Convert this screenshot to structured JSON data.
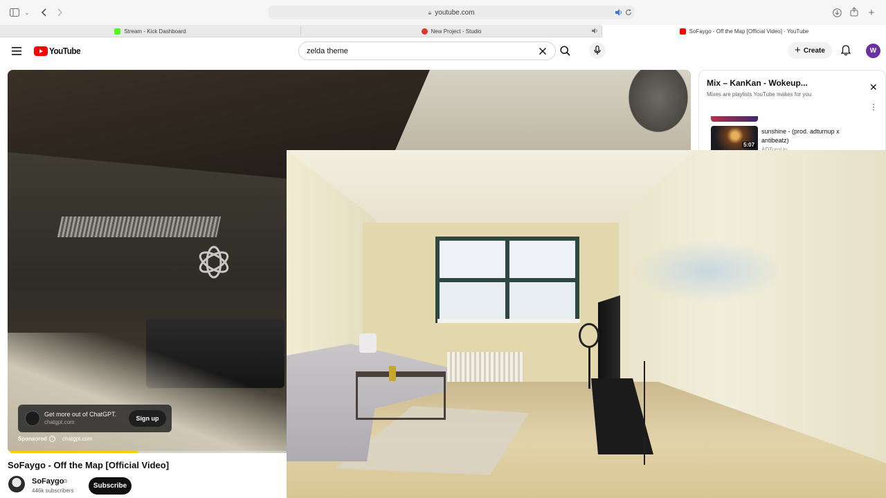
{
  "browser": {
    "address": "youtube.com",
    "tabs": [
      {
        "label": "Stream - Kick Dashboard",
        "favicon_color": "#53fc18"
      },
      {
        "label": "New Project - Studio",
        "favicon_color": "#e6332a"
      },
      {
        "label": "SoFaygo - Off the Map [Official Video] - YouTube",
        "favicon_color": "#ff0000"
      }
    ]
  },
  "youtube": {
    "logo_text": "YouTube",
    "search_value": "zelda theme",
    "create_label": "Create",
    "avatar_letter": "W"
  },
  "player": {
    "ad": {
      "title": "Get more out of ChatGPT.",
      "domain": "chatgpt.com",
      "cta": "Sign up",
      "sponsored": "Sponsored",
      "url": "chatgpt.com",
      "progress": 0.19
    }
  },
  "video": {
    "title": "SoFaygo - Off the Map [Official Video]",
    "channel": "SoFaygo",
    "subscribers": "446k subscribers",
    "subscribe_label": "Subscribe"
  },
  "mix": {
    "title": "Mix – KanKan - Wokeup...",
    "subtitle": "Mixes are playlists YouTube makes for you",
    "items": [
      {
        "title": "sunshine - (prod. adturnup x antibeatz)",
        "artist": "ADTurnUp",
        "duration": "5:07"
      }
    ]
  },
  "colors": {
    "youtube_red": "#ff0000",
    "avatar_purple": "#6b2fa3",
    "subscribe_black": "#0f0f0f"
  }
}
